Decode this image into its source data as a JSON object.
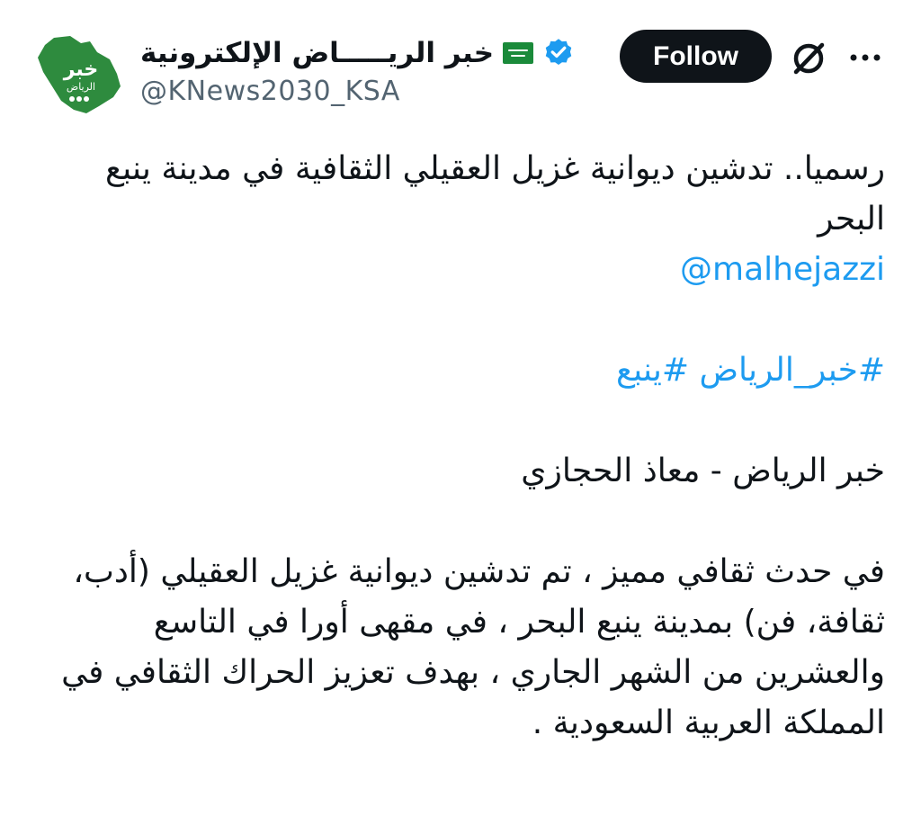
{
  "profile": {
    "display_name": "خبر الريـــــاض الإلكترونية",
    "handle": "@KNews2030_KSA",
    "avatar_text": "خبر",
    "avatar_subtext": "الرياض",
    "verified_icon": "verified-badge-icon",
    "flag_icon": "saudi-flag-icon"
  },
  "actions": {
    "follow_label": "Follow",
    "grok_icon": "grok-icon",
    "more_icon": "more-options-icon"
  },
  "tweet": {
    "headline": "رسميا.. تدشين ديوانية غزيل العقيلي الثقافية في مدينة ينبع البحر",
    "mention": "@malhejazzi",
    "hashtags": "#خبر_الرياض #ينبع",
    "byline": "خبر الرياض - معاذ الحجازي",
    "body": "في حدث ثقافي مميز ، تم تدشين ديوانية غزيل العقيلي (أدب، ثقافة، فن) بمدينة ينبع البحر ، في مقهى أورا في التاسع والعشرين من الشهر الجاري ، بهدف تعزيز الحراك الثقافي في المملكة العربية السعودية ."
  },
  "colors": {
    "text": "#0f1419",
    "secondary": "#536471",
    "link": "#1d9bf0",
    "verified": "#1d9bf0",
    "brand_green": "#2e8b3e",
    "button_bg": "#0f1419"
  }
}
